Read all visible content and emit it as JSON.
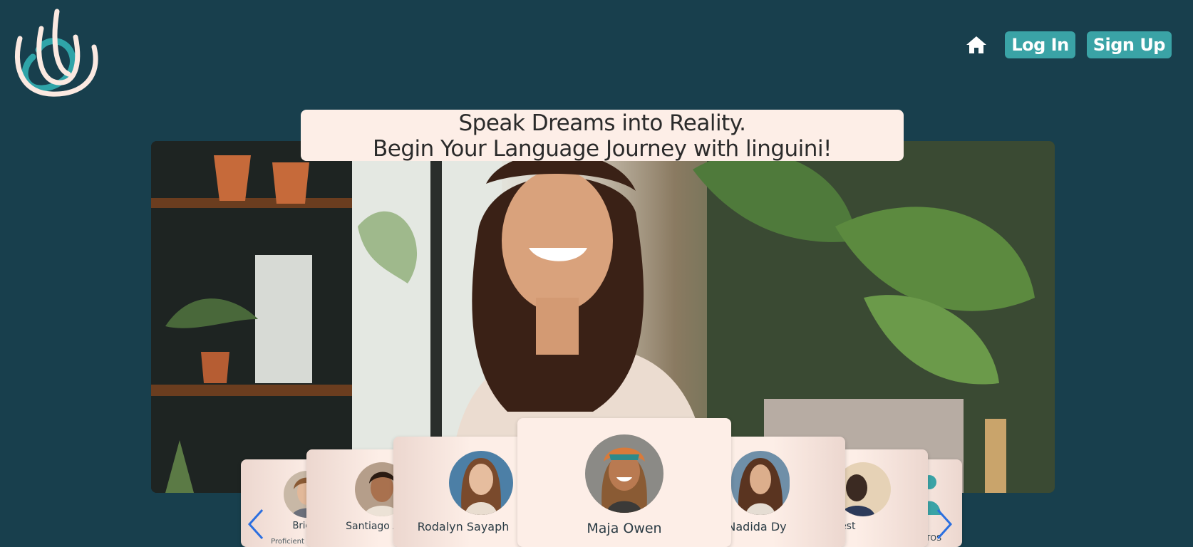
{
  "nav": {
    "home_icon": "home-icon",
    "login_label": "Log In",
    "signup_label": "Sign Up"
  },
  "hero": {
    "line1": "Speak Dreams into Reality.",
    "line2": "Begin Your Language Journey with linguini!"
  },
  "tutors": [
    {
      "name": "Brielle",
      "sub": "Proficient in Spanish"
    },
    {
      "name": "Santiago A",
      "sub": ""
    },
    {
      "name": "Rodalyn Sayaph",
      "sub": ""
    },
    {
      "name": "Maja Owen",
      "sub": ""
    },
    {
      "name": "Nadida Dy",
      "sub": ""
    },
    {
      "name": "e Nest",
      "sub": ""
    },
    {
      "name": "ANTOS",
      "sub": ""
    }
  ],
  "colors": {
    "background": "#183f4d",
    "accent": "#3aa3a6",
    "card": "#fdeee7",
    "arrow": "#2b6fe0"
  }
}
